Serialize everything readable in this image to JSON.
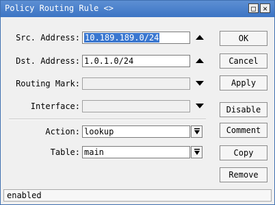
{
  "window": {
    "title": "Policy Routing Rule <>",
    "minimize_symbol": "□",
    "close_symbol": "✕"
  },
  "form": {
    "src_address": {
      "label": "Src. Address:",
      "value": "10.189.189.0/24"
    },
    "dst_address": {
      "label": "Dst. Address:",
      "value": "1.0.1.0/24"
    },
    "routing_mark": {
      "label": "Routing Mark:",
      "value": ""
    },
    "interface": {
      "label": "Interface:",
      "value": ""
    },
    "action": {
      "label": "Action:",
      "value": "lookup"
    },
    "table": {
      "label": "Table:",
      "value": "main"
    }
  },
  "buttons": {
    "ok": "OK",
    "cancel": "Cancel",
    "apply": "Apply",
    "disable": "Disable",
    "comment": "Comment",
    "copy": "Copy",
    "remove": "Remove"
  },
  "status": "enabled"
}
